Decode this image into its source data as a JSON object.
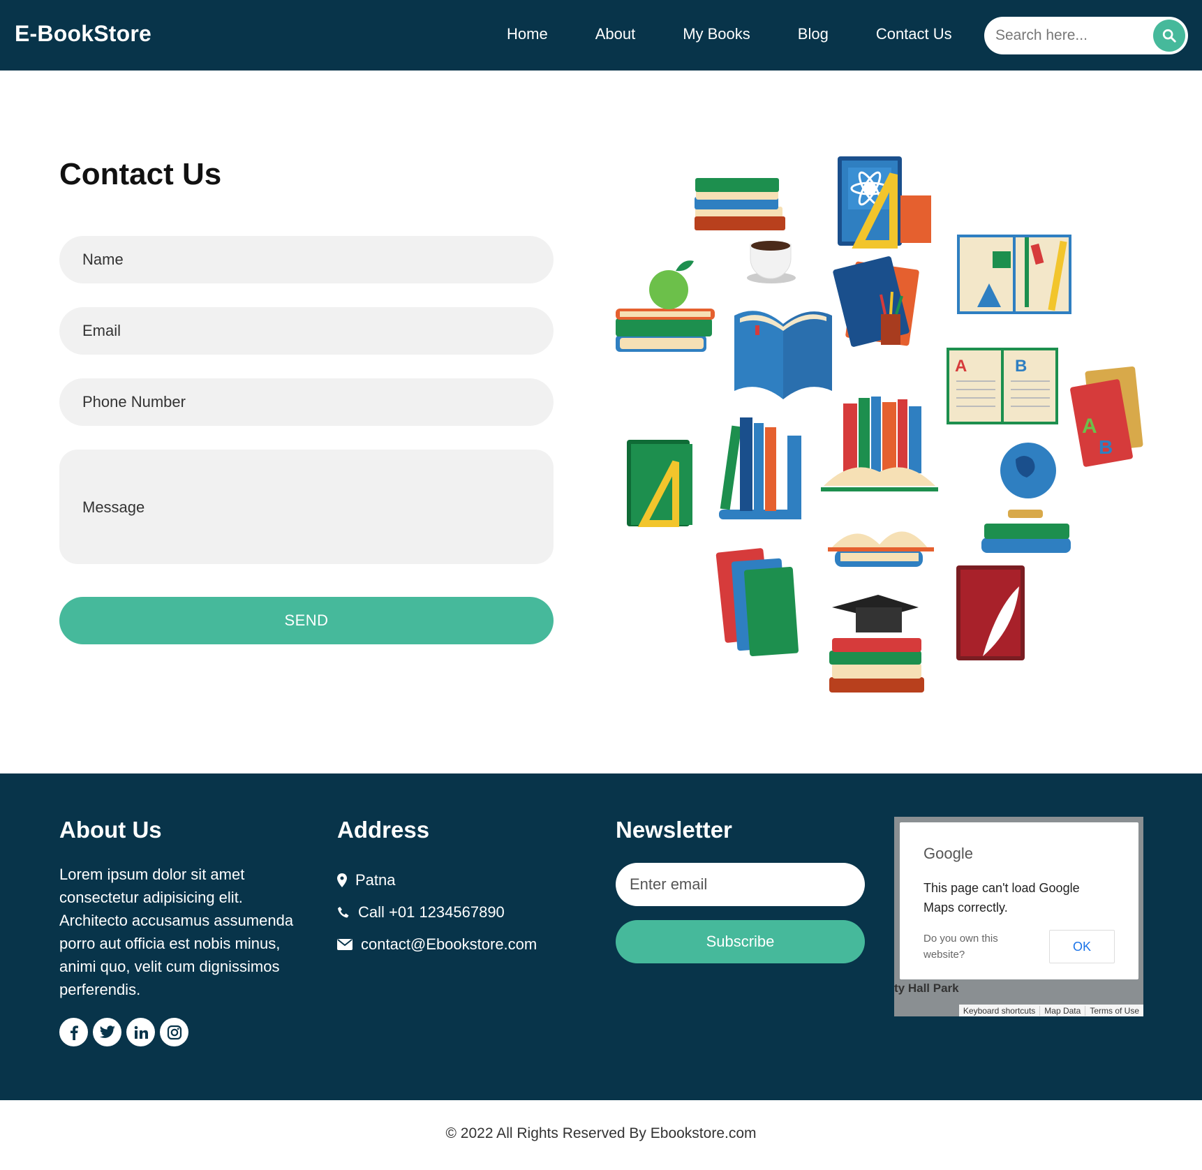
{
  "header": {
    "brand": "E-BookStore",
    "nav": [
      "Home",
      "About",
      "My Books",
      "Blog",
      "Contact Us"
    ],
    "search_placeholder": "Search here..."
  },
  "contact": {
    "title": "Contact Us",
    "name_placeholder": "Name",
    "email_placeholder": "Email",
    "phone_placeholder": "Phone Number",
    "message_placeholder": "Message",
    "send_label": "SEND"
  },
  "footer": {
    "about": {
      "heading": "About Us",
      "text": "Lorem ipsum dolor sit amet consectetur adipisicing elit. Architecto accusamus assumenda porro aut officia est nobis minus, animi quo, velit cum dignissimos perferendis."
    },
    "address": {
      "heading": "Address",
      "city": "Patna",
      "phone": "Call +01 1234567890",
      "email": "contact@Ebookstore.com"
    },
    "newsletter": {
      "heading": "Newsletter",
      "email_placeholder": "Enter email",
      "subscribe_label": "Subscribe"
    },
    "map": {
      "brand": "Google",
      "message": "This page can't load Google Maps correctly.",
      "question": "Do you own this website?",
      "ok_label": "OK",
      "park_label": "ty Hall Park",
      "bar": [
        "Keyboard shortcuts",
        "Map Data",
        "Terms of Use"
      ]
    },
    "social": [
      "facebook-icon",
      "twitter-icon",
      "linkedin-icon",
      "instagram-icon"
    ],
    "copyright": "© 2022 All Rights Reserved By Ebookstore.com"
  },
  "colors": {
    "navy": "#08344a",
    "accent": "#46b99b",
    "field_bg": "#f1f1f1"
  }
}
